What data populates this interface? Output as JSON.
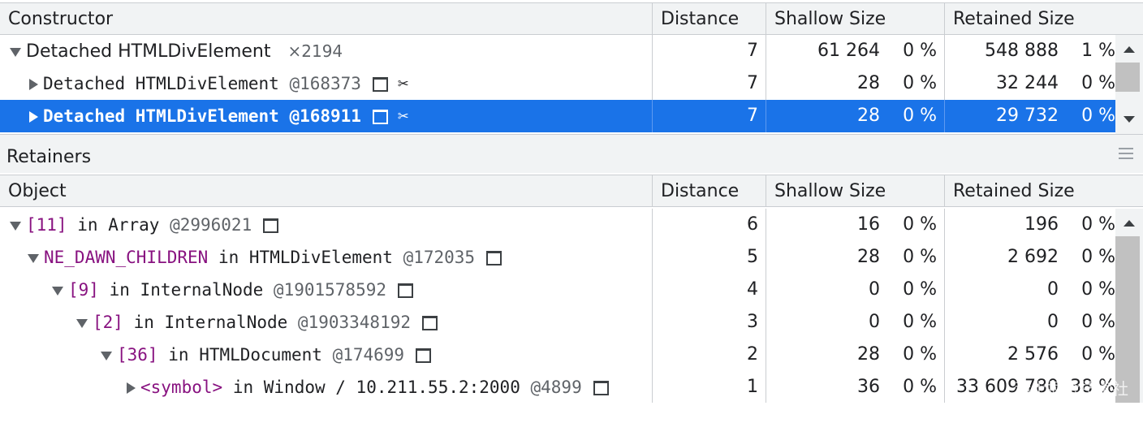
{
  "constructor_table": {
    "headers": {
      "name": "Constructor",
      "distance": "Distance",
      "shallow": "Shallow Size",
      "retained": "Retained Size"
    },
    "rows": [
      {
        "name": "Detached HTMLDivElement",
        "count": "×2194",
        "distance": "7",
        "shallow": "61 264",
        "shallow_pct": "0 %",
        "retained": "548 888",
        "retained_pct": "1 %"
      },
      {
        "name": "Detached HTMLDivElement",
        "id": "@168373",
        "distance": "7",
        "shallow": "28",
        "shallow_pct": "0 %",
        "retained": "32 244",
        "retained_pct": "0 %"
      },
      {
        "name": "Detached HTMLDivElement",
        "id": "@168911",
        "distance": "7",
        "shallow": "28",
        "shallow_pct": "0 %",
        "retained": "29 732",
        "retained_pct": "0 %"
      }
    ]
  },
  "retainers": {
    "title": "Retainers",
    "headers": {
      "name": "Object",
      "distance": "Distance",
      "shallow": "Shallow Size",
      "retained": "Retained Size"
    },
    "rows": [
      {
        "prop": "[11]",
        "in": "in",
        "type": "Array",
        "id": "@2996021",
        "distance": "6",
        "shallow": "16",
        "shallow_pct": "0 %",
        "retained": "196",
        "retained_pct": "0 %"
      },
      {
        "prop": "NE_DAWN_CHILDREN",
        "in": "in",
        "type": "HTMLDivElement",
        "id": "@172035",
        "distance": "5",
        "shallow": "28",
        "shallow_pct": "0 %",
        "retained": "2 692",
        "retained_pct": "0 %"
      },
      {
        "prop": "[9]",
        "in": "in",
        "type": "InternalNode",
        "id": "@1901578592",
        "distance": "4",
        "shallow": "0",
        "shallow_pct": "0 %",
        "retained": "0",
        "retained_pct": "0 %"
      },
      {
        "prop": "[2]",
        "in": "in",
        "type": "InternalNode",
        "id": "@1903348192",
        "distance": "3",
        "shallow": "0",
        "shallow_pct": "0 %",
        "retained": "0",
        "retained_pct": "0 %"
      },
      {
        "prop": "[36]",
        "in": "in",
        "type": "HTMLDocument",
        "id": "@174699",
        "distance": "2",
        "shallow": "28",
        "shallow_pct": "0 %",
        "retained": "2 576",
        "retained_pct": "0 %"
      },
      {
        "prop": "<symbol>",
        "in": "in",
        "type": "Window / 10.211.55.2:2000",
        "id": "@4899",
        "distance": "1",
        "shallow": "36",
        "shallow_pct": "0 %",
        "retained": "33 609 780",
        "retained_pct": "38 %"
      }
    ]
  },
  "watermark": "稀土掘金技术社区",
  "colors": {
    "selection": "#1a73e8",
    "property": "#881280"
  }
}
